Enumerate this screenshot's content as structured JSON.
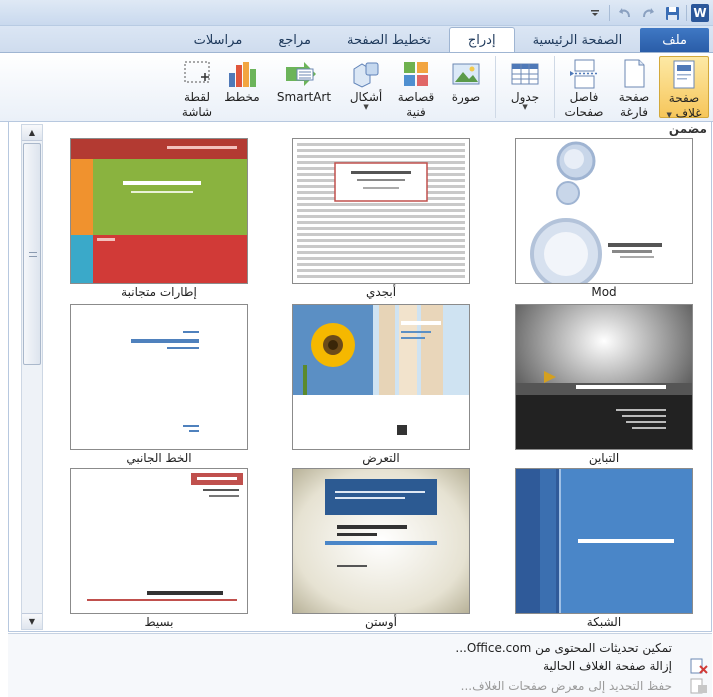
{
  "qat": {
    "word_icon": "W",
    "save_icon": "save-icon",
    "undo_icon": "undo-icon",
    "redo_icon": "redo-icon",
    "customize_icon": "customize-qat-icon"
  },
  "tabs": [
    {
      "label": "ملف",
      "state": "file"
    },
    {
      "label": "الصفحة الرئيسية",
      "state": "normal"
    },
    {
      "label": "إدراج",
      "state": "active"
    },
    {
      "label": "تخطيط الصفحة",
      "state": "normal"
    },
    {
      "label": "مراجع",
      "state": "normal"
    },
    {
      "label": "مراسلات",
      "state": "normal"
    }
  ],
  "ribbon": {
    "cover_page": "صفحة",
    "cover_page_2": "غلاف",
    "blank_page": "صفحة",
    "blank_page_2": "فارغة",
    "page_break": "فاصل",
    "page_break_2": "صفحات",
    "table": "جدول",
    "picture": "صورة",
    "clip_art": "قصاصة",
    "clip_art_2": "فنية",
    "shapes": "أشكال",
    "smartart": "SmartArt",
    "chart": "مخطط",
    "screenshot": "لقطة",
    "screenshot_2": "شاشة"
  },
  "gallery": {
    "section_title": "مضمن",
    "items": [
      {
        "caption": "Mod"
      },
      {
        "caption": "أبجدي"
      },
      {
        "caption": "إطارات متجانبة"
      },
      {
        "caption": "التباين"
      },
      {
        "caption": "التعرض"
      },
      {
        "caption": "الخط الجانبي"
      },
      {
        "caption": "الشبكة"
      },
      {
        "caption": "أوستن"
      },
      {
        "caption": "بسيط"
      }
    ]
  },
  "menu": {
    "enable_updates": "تمكين تحديثات المحتوى من Office.com...",
    "remove_cover": "إزالة صفحة الغلاف الحالية",
    "save_selection": "حفظ التحديد إلى معرض صفحات الغلاف..."
  },
  "colors": {
    "accent": "#2b579a",
    "file_tab": "#2a5da8",
    "active_button": "#f6c65b"
  }
}
